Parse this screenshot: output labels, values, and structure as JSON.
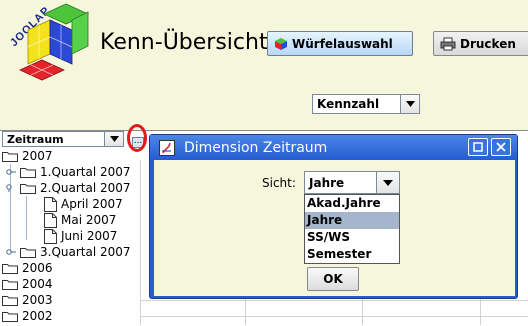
{
  "app": {
    "logo_text": "JOOLAP",
    "title": "Kenn-Übersicht",
    "cube_button": "Würfelauswahl",
    "print_button": "Drucken"
  },
  "kennzahl": {
    "value": "Kennzahl"
  },
  "zeitraum": {
    "value": "Zeitraum",
    "more_button": "..."
  },
  "tree": [
    {
      "label": "2007"
    },
    {
      "label": "1.Quartal 2007"
    },
    {
      "label": "2.Quartal 2007"
    },
    {
      "label": "April 2007"
    },
    {
      "label": "Mai 2007"
    },
    {
      "label": "Juni 2007"
    },
    {
      "label": "3.Quartal 2007"
    },
    {
      "label": "2006"
    },
    {
      "label": "2004"
    },
    {
      "label": "2003"
    },
    {
      "label": "2002"
    }
  ],
  "dialog": {
    "title": "Dimension Zeitraum",
    "sicht_label": "Sicht:",
    "selected": "Jahre",
    "options": [
      "Akad.Jahre",
      "Jahre",
      "SS/WS",
      "Semester"
    ],
    "ok": "OK"
  },
  "colors": {
    "accent": "#2a5bd0",
    "background": "#f6f6dc",
    "highlight": "#e21a1a"
  }
}
